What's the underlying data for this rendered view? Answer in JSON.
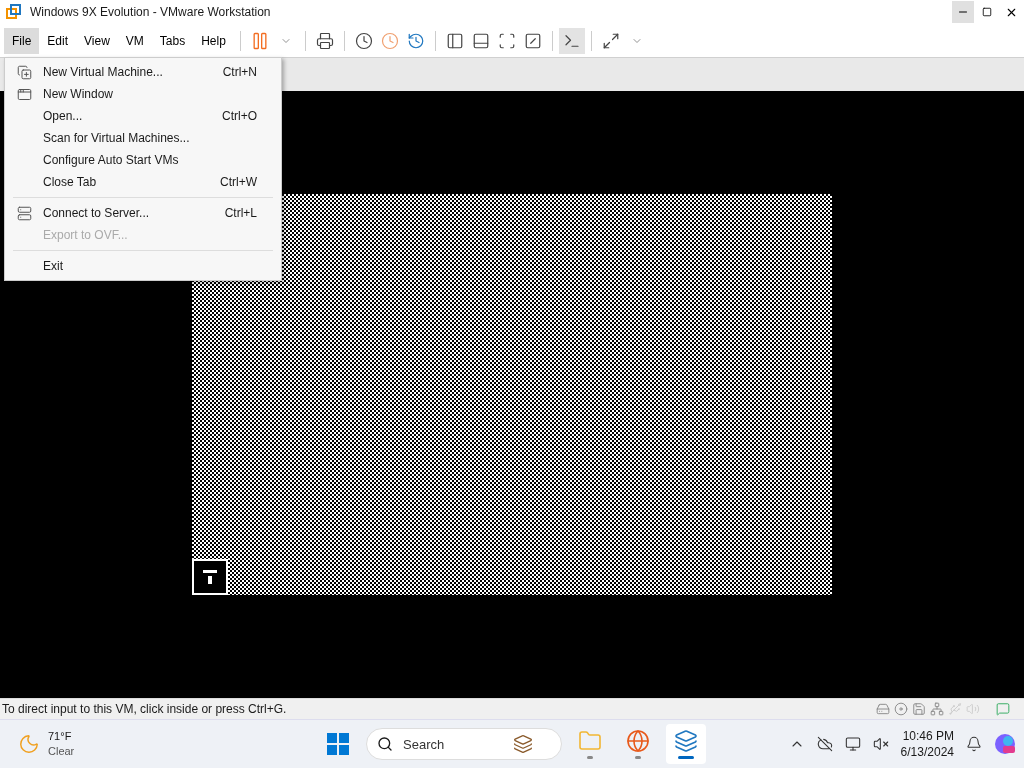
{
  "window": {
    "title": "Windows 9X Evolution - VMware Workstation"
  },
  "menubar": [
    {
      "label": "File",
      "selected": true
    },
    {
      "label": "Edit",
      "selected": false
    },
    {
      "label": "View",
      "selected": false
    },
    {
      "label": "VM",
      "selected": false
    },
    {
      "label": "Tabs",
      "selected": false
    },
    {
      "label": "Help",
      "selected": false
    }
  ],
  "file_menu": [
    {
      "kind": "item",
      "label": "New Virtual Machine...",
      "shortcut": "Ctrl+N",
      "disabled": false
    },
    {
      "kind": "item",
      "label": "New Window",
      "disabled": false
    },
    {
      "kind": "item",
      "label": "Open...",
      "shortcut": "Ctrl+O",
      "disabled": false
    },
    {
      "kind": "item",
      "label": "Scan for Virtual Machines...",
      "disabled": false
    },
    {
      "kind": "item",
      "label": "Configure Auto Start VMs",
      "disabled": false
    },
    {
      "kind": "item",
      "label": "Close Tab",
      "shortcut": "Ctrl+W",
      "disabled": false
    },
    {
      "kind": "separator"
    },
    {
      "kind": "item",
      "label": "Connect to Server...",
      "shortcut": "Ctrl+L",
      "disabled": false
    },
    {
      "kind": "item",
      "label": "Export to OVF...",
      "disabled": true
    },
    {
      "kind": "separator"
    },
    {
      "kind": "item",
      "label": "Exit",
      "disabled": false
    }
  ],
  "status_bar": {
    "text": "To direct input to this VM, click inside or press Ctrl+G."
  },
  "taskbar": {
    "weather": {
      "temperature": "71°F",
      "condition": "Clear"
    },
    "search": {
      "placeholder": "Search"
    },
    "apps": [
      {
        "active": false
      },
      {
        "active": false
      },
      {
        "active": true
      }
    ],
    "clock": {
      "time": "10:46 PM",
      "date": "6/13/2024"
    }
  }
}
